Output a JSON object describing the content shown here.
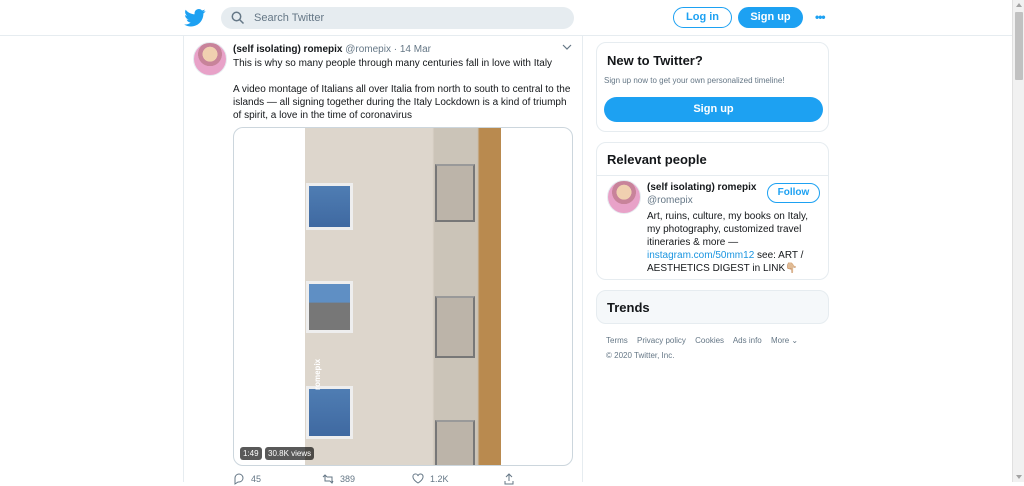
{
  "search": {
    "placeholder": "Search Twitter"
  },
  "header": {
    "login_label": "Log in",
    "signup_label": "Sign up",
    "more_label": "•••"
  },
  "tweet": {
    "name": "(self isolating) romepix",
    "handle": "@romepix",
    "time": "· 14 Mar",
    "text_1": "This is why so many people through many centuries fall in  love with Italy",
    "text_2": "A video montage of Italians all over Italia from north to south to central to the islands — all signing together during the Italy Lockdown is a kind of triumph of spirit, a love in the time of coronavirus",
    "watermark": "romepix",
    "duration": "1:49",
    "views": "30.8K views",
    "replies": "45",
    "retweets": "389",
    "likes": "1.2K"
  },
  "new_to_twitter": {
    "title": "New to Twitter?",
    "subtitle": "Sign up now to get your own personalized timeline!",
    "signup_label": "Sign up"
  },
  "relevant_people": {
    "title": "Relevant people",
    "name": "(self isolating) romepix",
    "handle": "@romepix",
    "follow_label": "Follow",
    "bio_1": "Art, ruins, culture, my books on Italy, my photography, customized travel itineraries & more —",
    "bio_link": "instagram.com/50mm12",
    "bio_2": "see: ART / AESTHETICS DIGEST in LINK👇🏼"
  },
  "trends": {
    "title": "Trends"
  },
  "footer": {
    "terms": "Terms",
    "privacy": "Privacy policy",
    "cookies": "Cookies",
    "ads": "Ads info",
    "more": "More ⌄",
    "copyright": "© 2020 Twitter, Inc."
  },
  "colors": {
    "accent": "#1da1f2",
    "text": "#14171a",
    "secondary": "#657786",
    "border": "#e6ecf0"
  }
}
